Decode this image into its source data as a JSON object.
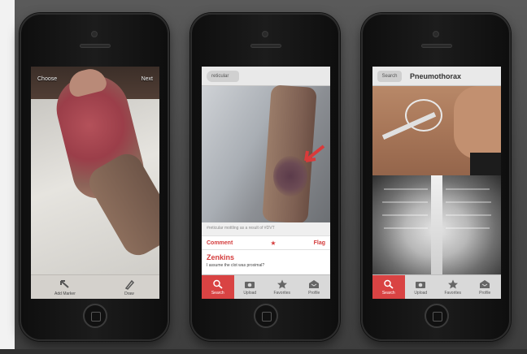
{
  "phone_left": {
    "navbar": {
      "left_label": "Choose",
      "right_label": "Next"
    },
    "toolbar": [
      {
        "label": "Add Marker",
        "icon": "arrow-up-left-icon"
      },
      {
        "label": "Draw",
        "icon": "pen-icon"
      }
    ]
  },
  "phone_center": {
    "search_tag": "reticular",
    "caption": "#reticular mottling as a result of #DVT",
    "actions": {
      "comment": "Comment",
      "flag": "Flag"
    },
    "comment": {
      "author": "Zenkins",
      "text": "I assume the clot was proximal?"
    },
    "tabbar": [
      {
        "label": "Search",
        "icon": "magnifier-icon",
        "active": true
      },
      {
        "label": "Upload",
        "icon": "camera-icon",
        "active": false
      },
      {
        "label": "Favorites",
        "icon": "star-icon",
        "active": false
      },
      {
        "label": "Profile",
        "icon": "inbox-icon",
        "active": false
      }
    ]
  },
  "phone_right": {
    "header": {
      "search_label": "Search",
      "title": "Pneumothorax"
    },
    "tabbar": [
      {
        "label": "Search",
        "icon": "magnifier-icon",
        "active": true
      },
      {
        "label": "Upload",
        "icon": "camera-icon",
        "active": false
      },
      {
        "label": "Favorites",
        "icon": "star-icon",
        "active": false
      },
      {
        "label": "Profile",
        "icon": "inbox-icon",
        "active": false
      }
    ]
  },
  "colors": {
    "accent": "#d94343",
    "background": "#4a4a4a"
  }
}
